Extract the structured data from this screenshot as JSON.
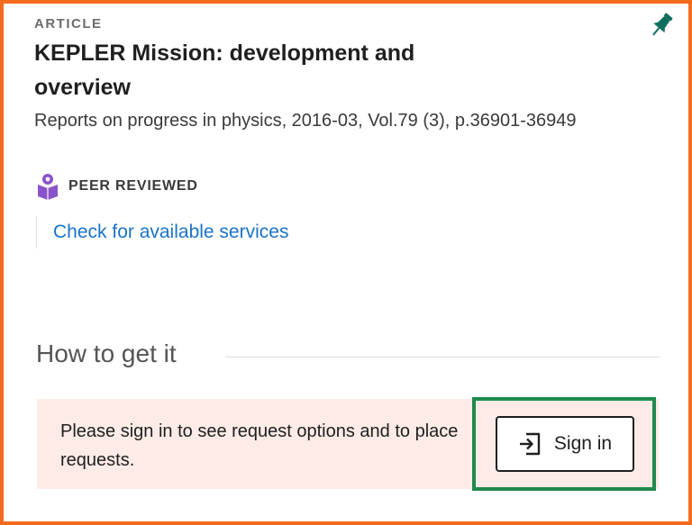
{
  "record": {
    "type_label": "ARTICLE",
    "title": "KEPLER Mission: development and overview",
    "citation": "Reports on progress in physics, 2016-03, Vol.79 (3), p.36901-36949",
    "peer_reviewed_label": "PEER REVIEWED",
    "services_link": "Check for available services"
  },
  "get_it": {
    "heading": "How to get it",
    "signin_message": "Please sign in to see request options and to place requests.",
    "signin_button_label": "Sign in"
  },
  "colors": {
    "card_border": "#f26b1d",
    "focus_outline": "#1f8a4c",
    "panel_bg": "#fcebe6",
    "link": "#1a73c9",
    "pin": "#0d6e5f",
    "peer_badge": "#8b52c9"
  },
  "icons": {
    "pin": "pin-icon",
    "peer_reviewed": "peer-reviewed-icon",
    "sign_in": "sign-in-icon"
  }
}
